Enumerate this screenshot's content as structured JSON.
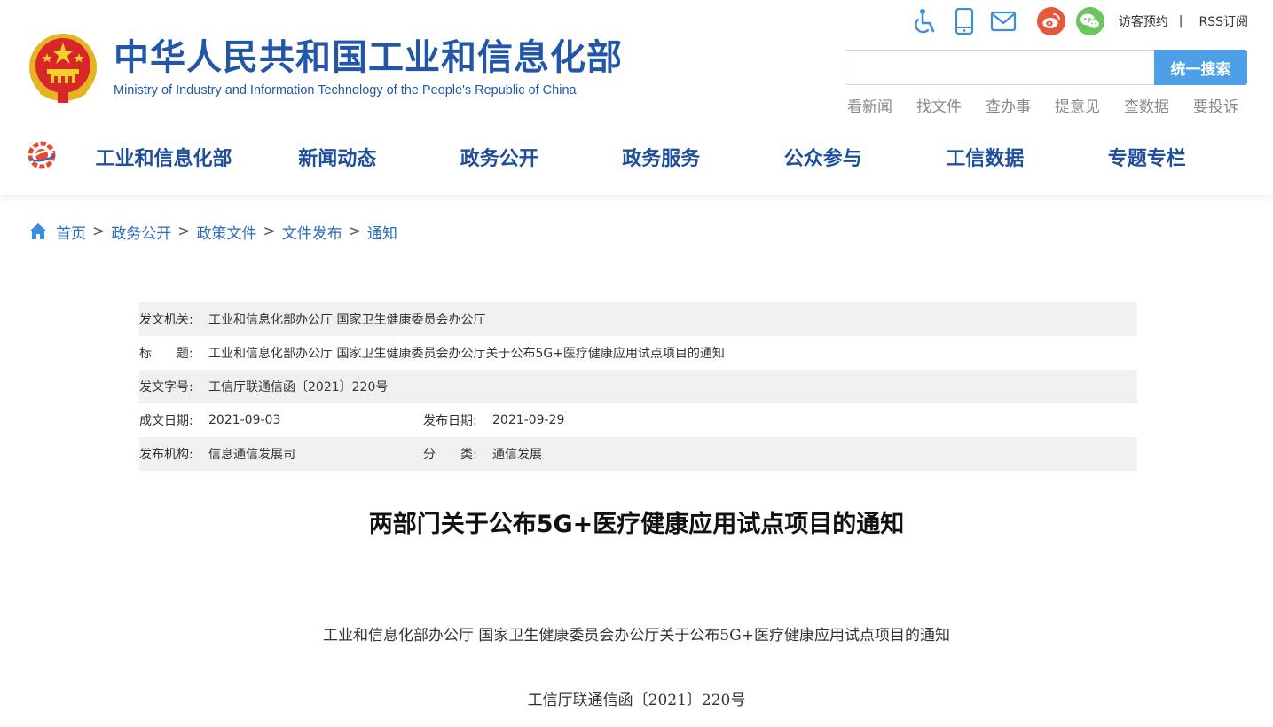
{
  "header": {
    "title": "中华人民共和国工业和信息化部",
    "subtitle": "Ministry of Industry and Information Technology of the People's Republic of China",
    "icons": [
      "accessibility-icon",
      "mobile-icon",
      "mail-icon",
      "weibo-icon",
      "wechat-icon"
    ],
    "visitor_booking": "访客预约",
    "separator": "|",
    "rss": "RSS订阅",
    "search": {
      "value": "",
      "placeholder": "",
      "button_label": "统一搜索"
    },
    "quick_links": [
      "看新闻",
      "找文件",
      "查办事",
      "提意见",
      "查数据",
      "要投诉"
    ],
    "colors": {
      "brand_blue": "#2257a8",
      "search_button": "#4da0e8",
      "weibo": "#e8573d",
      "wechat": "#6cc55d"
    }
  },
  "nav": {
    "items": [
      "工业和信息化部",
      "新闻动态",
      "政务公开",
      "政务服务",
      "公众参与",
      "工信数据",
      "专题专栏"
    ]
  },
  "breadcrumb": {
    "items": [
      "首页",
      "政务公开",
      "政策文件",
      "文件发布",
      "通知"
    ],
    "separator": ">"
  },
  "info": {
    "issuer_label": "发文机关:",
    "issuer": "工业和信息化部办公厅 国家卫生健康委员会办公厅",
    "title_label": "标　　题:",
    "title": "工业和信息化部办公厅 国家卫生健康委员会办公厅关于公布5G+医疗健康应用试点项目的通知",
    "doc_number_label": "发文字号:",
    "doc_number": "工信厅联通信函〔2021〕220号",
    "created_label": "成文日期:",
    "created": "2021-09-03",
    "published_label": "发布日期:",
    "published": "2021-09-29",
    "agency_label": "发布机构:",
    "agency": "信息通信发展司",
    "category_label": "分　　类:",
    "category": "通信发展"
  },
  "article": {
    "title": "两部门关于公布5G+医疗健康应用试点项目的通知",
    "paragraphs": [
      "工业和信息化部办公厅 国家卫生健康委员会办公厅关于公布5G+医疗健康应用试点项目的通知",
      "工信厅联通信函〔2021〕220号"
    ]
  }
}
